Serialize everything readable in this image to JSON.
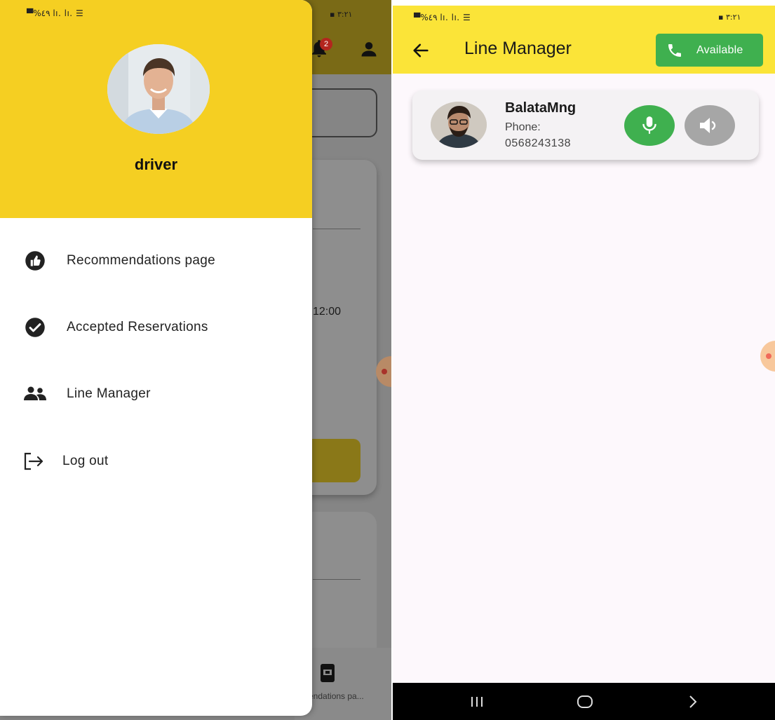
{
  "left_screen": {
    "status_bar": {
      "left": "▀%٤٩ lı. lı. ☰",
      "right": "▪ ٣:٢١"
    },
    "behind": {
      "notification_count": "2",
      "time_text": "12:00",
      "bottom_nav_label": "endations pa..."
    },
    "drawer": {
      "user_name": "driver",
      "menu": [
        {
          "label": "Recommendations page",
          "icon": "thumb-up-icon"
        },
        {
          "label": "Accepted Reservations",
          "icon": "check-circle-icon"
        },
        {
          "label": "Line Manager",
          "icon": "people-icon"
        },
        {
          "label": "Log out",
          "icon": "logout-icon"
        }
      ]
    }
  },
  "right_screen": {
    "status_bar": {
      "left": "▀%٤٩ lı. lı. ☰",
      "right": "▪ ٣:٢١"
    },
    "appbar": {
      "title": "Line Manager",
      "available_label": "Available"
    },
    "contact": {
      "name": "BalataMng",
      "phone_label": "Phone:",
      "phone": "0568243138"
    }
  },
  "colors": {
    "drawer_header": "#f5cf22",
    "appbar": "#fbe438",
    "green": "#3fb04f",
    "grey_button": "#a6a6a6"
  }
}
